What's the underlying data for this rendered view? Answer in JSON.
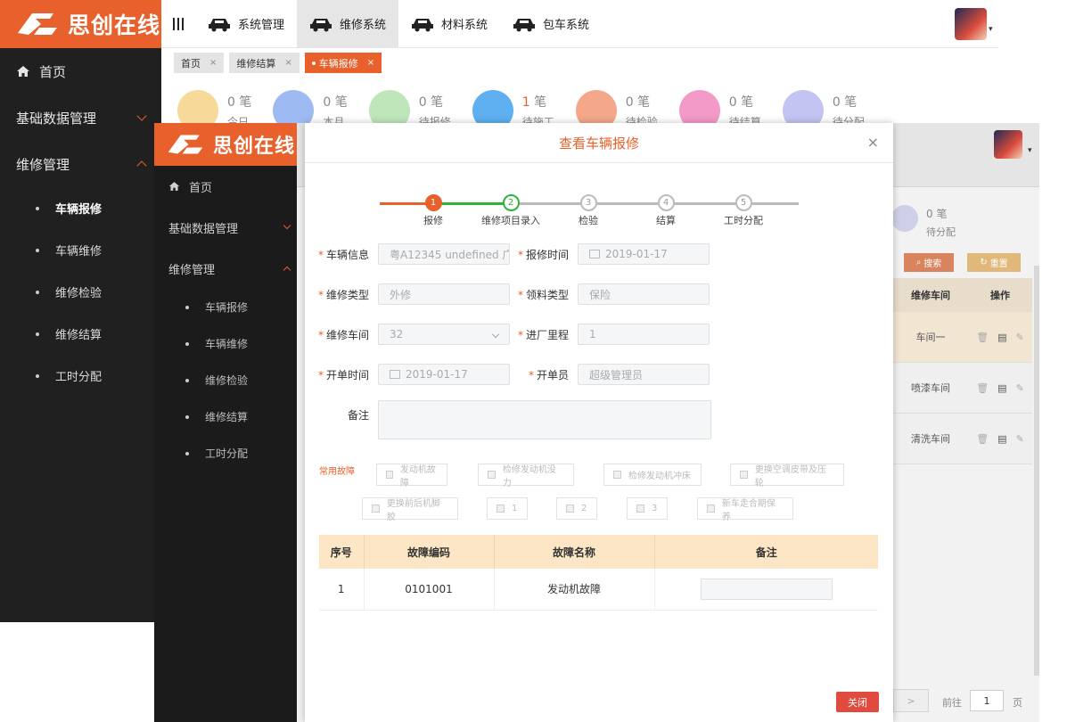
{
  "brand": {
    "name": "思创在线",
    "accent": "#e8602c"
  },
  "back": {
    "top_nav": [
      {
        "label": "系统管理"
      },
      {
        "label": "维修系统"
      },
      {
        "label": "材料系统"
      },
      {
        "label": "包车系统"
      }
    ],
    "tabs": [
      {
        "label": "首页"
      },
      {
        "label": "维修结算"
      },
      {
        "label": "车辆报修"
      }
    ],
    "sidebar": {
      "home": "首页",
      "basic": "基础数据管理",
      "repair": "维修管理",
      "subs": [
        "车辆报修",
        "车辆维修",
        "维修检验",
        "维修结算",
        "工时分配"
      ]
    },
    "stats": [
      {
        "count": "0",
        "unit": "笔",
        "label": "今日",
        "color": "#f7d999"
      },
      {
        "count": "0",
        "unit": "笔",
        "label": "本月",
        "color": "#9dbaf2"
      },
      {
        "count": "0",
        "unit": "笔",
        "label": "待报修",
        "color": "#bfe5bb"
      },
      {
        "count": "1",
        "unit": "笔",
        "label": "待施工",
        "color": "#5fb0f0"
      },
      {
        "count": "0",
        "unit": "笔",
        "label": "待检验",
        "color": "#f4a889"
      },
      {
        "count": "0",
        "unit": "笔",
        "label": "待结算",
        "color": "#f39ac8"
      },
      {
        "count": "0",
        "unit": "笔",
        "label": "待分配",
        "color": "#c4c4f2"
      }
    ]
  },
  "overlay": {
    "stat": {
      "count": "0",
      "unit": "笔",
      "label": "待分配"
    },
    "search_btn": "搜索",
    "reset_btn": "重置",
    "col_workshop": "维修车间",
    "col_action": "操作",
    "rows": [
      "车间一",
      "喷漆车间",
      "清洗车间"
    ],
    "pager": {
      "goto": "前往",
      "page": "1",
      "suffix": "页"
    }
  },
  "dialog": {
    "title": "查看车辆报修",
    "close_icon": "×",
    "steps": [
      {
        "n": "1",
        "label": "报修"
      },
      {
        "n": "2",
        "label": "维修项目录入"
      },
      {
        "n": "3",
        "label": "检验"
      },
      {
        "n": "4",
        "label": "结算"
      },
      {
        "n": "5",
        "label": "工时分配"
      }
    ],
    "fields": {
      "vehicle": {
        "label": "车辆信息",
        "value": "粤A12345 undefined 广"
      },
      "report_time": {
        "label": "报修时间",
        "value": "2019-01-17"
      },
      "repair_type": {
        "label": "维修类型",
        "value": "外修"
      },
      "material_type": {
        "label": "领料类型",
        "value": "保险"
      },
      "workshop": {
        "label": "维修车间",
        "value": "32"
      },
      "mileage": {
        "label": "进厂里程",
        "value": "1"
      },
      "open_time": {
        "label": "开单时间",
        "value": "2019-01-17"
      },
      "opener": {
        "label": "开单员",
        "value": "超级管理员"
      },
      "remark": {
        "label": "备注",
        "value": ""
      }
    },
    "faults_label": "常用故障",
    "faults": [
      "发动机故障",
      "检修发动机没力",
      "检修发动机冲床",
      "更换空调皮带及压轮",
      "更换前后机脚胶",
      "1",
      "2",
      "3",
      "新车走合期保养"
    ],
    "table": {
      "headers": [
        "序号",
        "故障编码",
        "故障名称",
        "备注"
      ],
      "rows": [
        {
          "no": "1",
          "code": "0101001",
          "name": "发动机故障",
          "remark": ""
        }
      ]
    },
    "close_btn": "关闭"
  }
}
